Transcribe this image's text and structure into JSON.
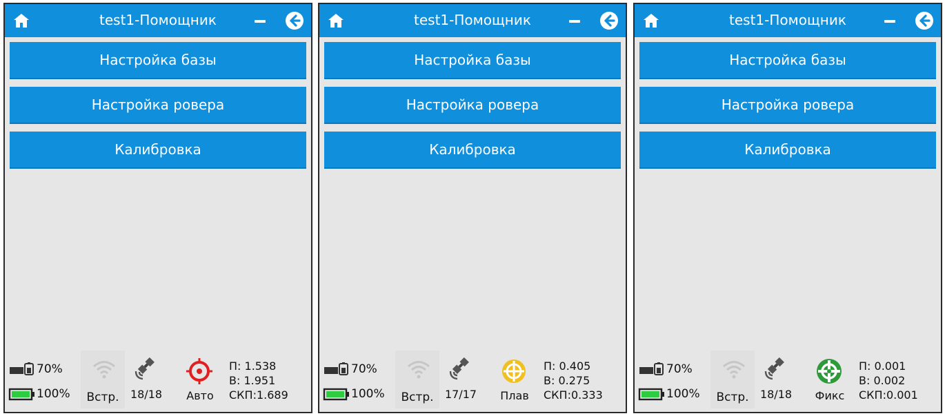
{
  "colors": {
    "header": "#0f8fdc",
    "background": "#e6e6e6",
    "fix_auto": "#e02020",
    "fix_float": "#f0c020",
    "fix_fixed": "#2e9a3a",
    "battery_green": "#2ecc40"
  },
  "icons": {
    "home": "home-icon",
    "minimize": "minimize-icon",
    "back": "back-arrow-icon",
    "battery": "battery-icon",
    "wifi": "wifi-icon",
    "satellite": "satellite-icon",
    "fix": "crosshair-icon"
  },
  "panels": [
    {
      "title": "test1-Помощник",
      "menu": [
        "Настройка базы",
        "Настройка ровера",
        "Калибровка"
      ],
      "status": {
        "battery_top": "70%",
        "battery_bottom": "100%",
        "link_label": "Встр.",
        "satellites": "18/18",
        "fix_label": "Авто",
        "fix_color": "#e02020",
        "p": "П:  1.538",
        "v": "В:  1.951",
        "skp": "СКП:1.689"
      }
    },
    {
      "title": "test1-Помощник",
      "menu": [
        "Настройка базы",
        "Настройка ровера",
        "Калибровка"
      ],
      "status": {
        "battery_top": "70%",
        "battery_bottom": "100%",
        "link_label": "Встр.",
        "satellites": "17/17",
        "fix_label": "Плав",
        "fix_color": "#f0c020",
        "p": "П:  0.405",
        "v": "В:  0.275",
        "skp": "СКП:0.333"
      }
    },
    {
      "title": "test1-Помощник",
      "menu": [
        "Настройка базы",
        "Настройка ровера",
        "Калибровка"
      ],
      "status": {
        "battery_top": "70%",
        "battery_bottom": "100%",
        "link_label": "Встр.",
        "satellites": "18/18",
        "fix_label": "Фикс",
        "fix_color": "#2e9a3a",
        "p": "П:  0.001",
        "v": "В:  0.002",
        "skp": "СКП:0.001"
      }
    }
  ]
}
